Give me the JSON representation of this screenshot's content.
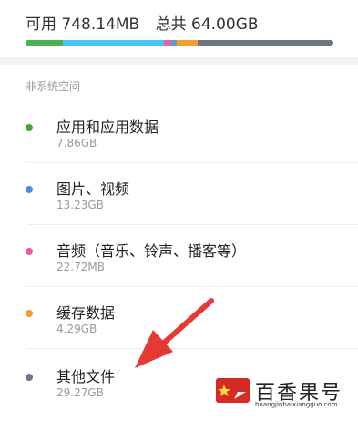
{
  "storage": {
    "available_label": "可用",
    "available_value": "748.14MB",
    "total_label": "总共",
    "total_value": "64.00GB"
  },
  "usage_bar": {
    "segments": [
      {
        "name": "apps",
        "color": "#4caf50",
        "fraction": 0.12
      },
      {
        "name": "media",
        "color": "#4fc3f7",
        "fraction": 0.33
      },
      {
        "name": "audio",
        "color": "#f06292",
        "fraction": 0.02
      },
      {
        "name": "other-blue",
        "color": "#6f8fd6",
        "fraction": 0.02
      },
      {
        "name": "cache",
        "color": "#f0a030",
        "fraction": 0.07
      }
    ],
    "remainder_color": "#6e7683"
  },
  "section": {
    "title": "非系统空间"
  },
  "items": [
    {
      "title": "应用和应用数据",
      "size": "7.86GB",
      "color": "#3fa535"
    },
    {
      "title": "图片、视频",
      "size": "13.23GB",
      "color": "#4a8ee0"
    },
    {
      "title": "音频（音乐、铃声、播客等）",
      "size": "22.72MB",
      "color": "#e85aa0"
    },
    {
      "title": "缓存数据",
      "size": "4.29GB",
      "color": "#f0a030"
    },
    {
      "title": "其他文件",
      "size": "29.27GB",
      "color": "#6b7886"
    }
  ],
  "watermark": {
    "title": "百香果号",
    "url": "huangjinbaixiangguo.com"
  },
  "colors": {
    "arrow": "#e53935"
  }
}
